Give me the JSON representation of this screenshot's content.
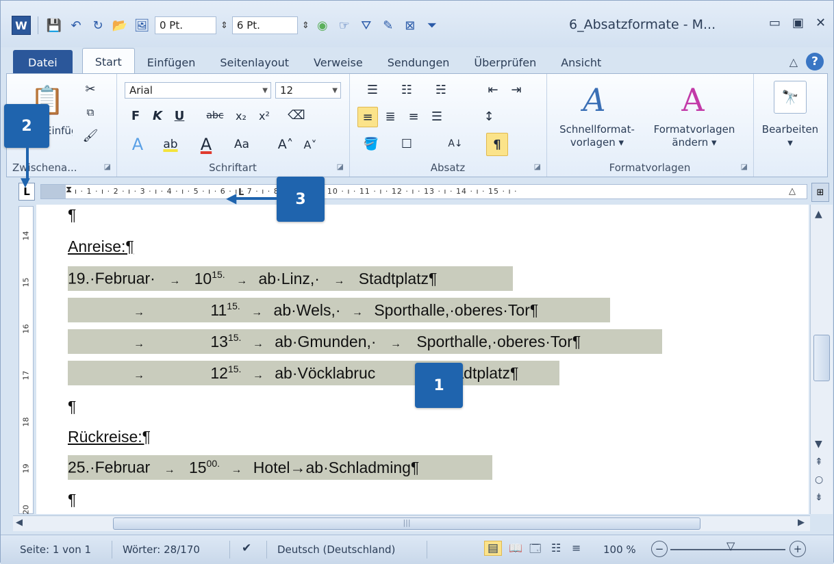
{
  "qat": {
    "logo": "W",
    "space_before": "0 Pt.",
    "space_after": "6 Pt.",
    "spin": "⇕"
  },
  "window": {
    "title": "6_Absatzformate - M...",
    "minimize": "▭",
    "restore": "▣",
    "close": "✕"
  },
  "tabs": [
    "Datei",
    "Start",
    "Einfügen",
    "Seitenlayout",
    "Verweise",
    "Sendungen",
    "Überprüfen",
    "Ansicht"
  ],
  "help": "?",
  "collapse": "△",
  "ribbon": {
    "clipboard": {
      "label": "Zwischena...",
      "paste": "Einfügen"
    },
    "font": {
      "label": "Schriftart",
      "name": "Arial",
      "size": "12",
      "bold": "F",
      "italic": "K",
      "underline": "U",
      "strike": "abc",
      "sub": "x₂",
      "sup": "x²",
      "text_effects": "A",
      "highlight": "ab",
      "font_color": "A",
      "case": "Aa",
      "grow": "A˄",
      "shrink": "A˅"
    },
    "paragraph": {
      "label": "Absatz",
      "pilcrow": "¶",
      "sort": "A↓"
    },
    "styles": {
      "label": "Formatvorlagen",
      "quick": "Schnellformat-\nvorlagen ▾",
      "change": "Formatvorlagen\nändern ▾"
    },
    "editing": {
      "label": "Bearbeiten"
    }
  },
  "ruler": {
    "tab_selector": "L",
    "ticks": "· ı · 1 · ı · 2 · ı · 3 · ı · 4 · ı · 5 · ı · 6 · ı · 7 · ı · 8 · ı · 9 · ı · 10 · ı · 11 · ı · 12 · ı · 13 · ı · 14 · ı · 15 · ı ·",
    "vertical_numbers": [
      "14",
      "15",
      "16",
      "17",
      "18",
      "19",
      "20"
    ]
  },
  "document": {
    "lines": [
      {
        "text": "¶"
      },
      {
        "text": "Anreise:¶"
      },
      {
        "date": "19.·Februar·",
        "arrow": "→",
        "hour": "10",
        "minute": "15.",
        "from": "ab·Linz,·",
        "place": "Stadtplatz¶"
      },
      {
        "arrow0": "→",
        "hour": "11",
        "minute": "15.",
        "from": "ab·Wels,·",
        "place": "Sporthalle,·oberes·Tor¶"
      },
      {
        "arrow0": "→",
        "hour": "13",
        "minute": "15.",
        "from": "ab·Gmunden,·",
        "place": "Sporthalle,·oberes·Tor¶"
      },
      {
        "arrow0": "→",
        "hour": "12",
        "minute": "15.",
        "from": "ab·Vöcklabruc",
        "place": "Stadtplatz¶"
      },
      {
        "text": "¶"
      },
      {
        "text": "Rückreise:¶"
      },
      {
        "date": "25.·Februar",
        "arrow": "→",
        "hour": "15",
        "minute": "00.",
        "from": "Hotel→ab·Schladming¶"
      },
      {
        "text": "¶"
      }
    ]
  },
  "callouts": [
    "1",
    "2",
    "3"
  ],
  "status": {
    "page": "Seite: 1 von 1",
    "words": "Wörter: 28/170",
    "language": "Deutsch (Deutschland)",
    "zoom": "100 %",
    "zoom_minus": "−",
    "zoom_plus": "+"
  },
  "colors": {
    "file_tab": "#2b579a",
    "callout": "#1f64ae",
    "highlight": "#c9ccbd"
  }
}
